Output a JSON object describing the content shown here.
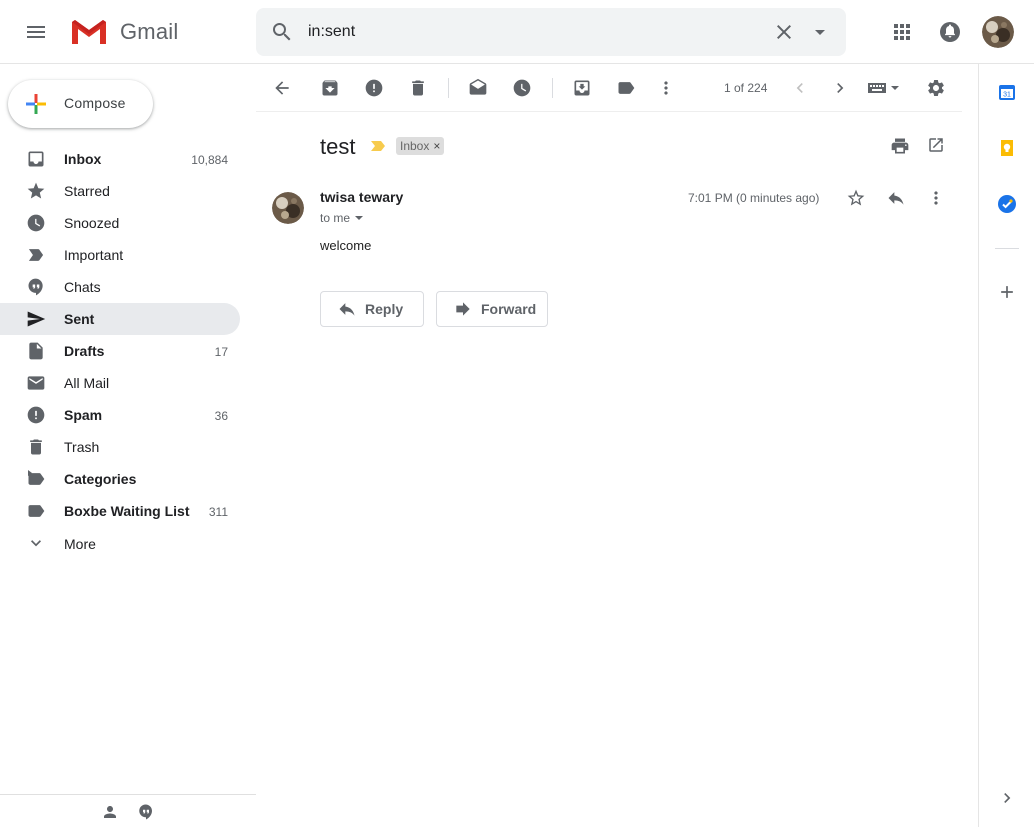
{
  "app": {
    "name": "Gmail"
  },
  "search": {
    "query": "in:sent"
  },
  "compose": {
    "label": "Compose"
  },
  "nav": {
    "items": [
      {
        "label": "Inbox",
        "count": "10,884",
        "icon": "inbox-icon"
      },
      {
        "label": "Starred",
        "count": "",
        "icon": "star-icon"
      },
      {
        "label": "Snoozed",
        "count": "",
        "icon": "clock-icon"
      },
      {
        "label": "Important",
        "count": "",
        "icon": "label-important-icon"
      },
      {
        "label": "Chats",
        "count": "",
        "icon": "chat-icon"
      },
      {
        "label": "Sent",
        "count": "",
        "icon": "send-icon"
      },
      {
        "label": "Drafts",
        "count": "17",
        "icon": "draft-icon"
      },
      {
        "label": "All Mail",
        "count": "",
        "icon": "mail-icon"
      },
      {
        "label": "Spam",
        "count": "36",
        "icon": "report-icon"
      },
      {
        "label": "Trash",
        "count": "",
        "icon": "trash-icon"
      },
      {
        "label": "Categories",
        "count": "",
        "icon": "label-icon"
      },
      {
        "label": "Boxbe Waiting List",
        "count": "311",
        "icon": "label-icon"
      },
      {
        "label": "More",
        "count": "",
        "icon": "chevron-down-icon"
      }
    ]
  },
  "toolbar": {
    "page_count": "1 of 224"
  },
  "message": {
    "subject": "test",
    "chip": "Inbox",
    "sender": "twisa tewary",
    "recipients": "to me",
    "time": "7:01 PM (0 minutes ago)",
    "body": "welcome",
    "reply_label": "Reply",
    "forward_label": "Forward"
  },
  "colors": {
    "accent_red": "#d93025",
    "active_nav_bg": "#e8eaed",
    "importance_yellow": "#f7cb4d",
    "chip_bg": "#dddddd"
  }
}
